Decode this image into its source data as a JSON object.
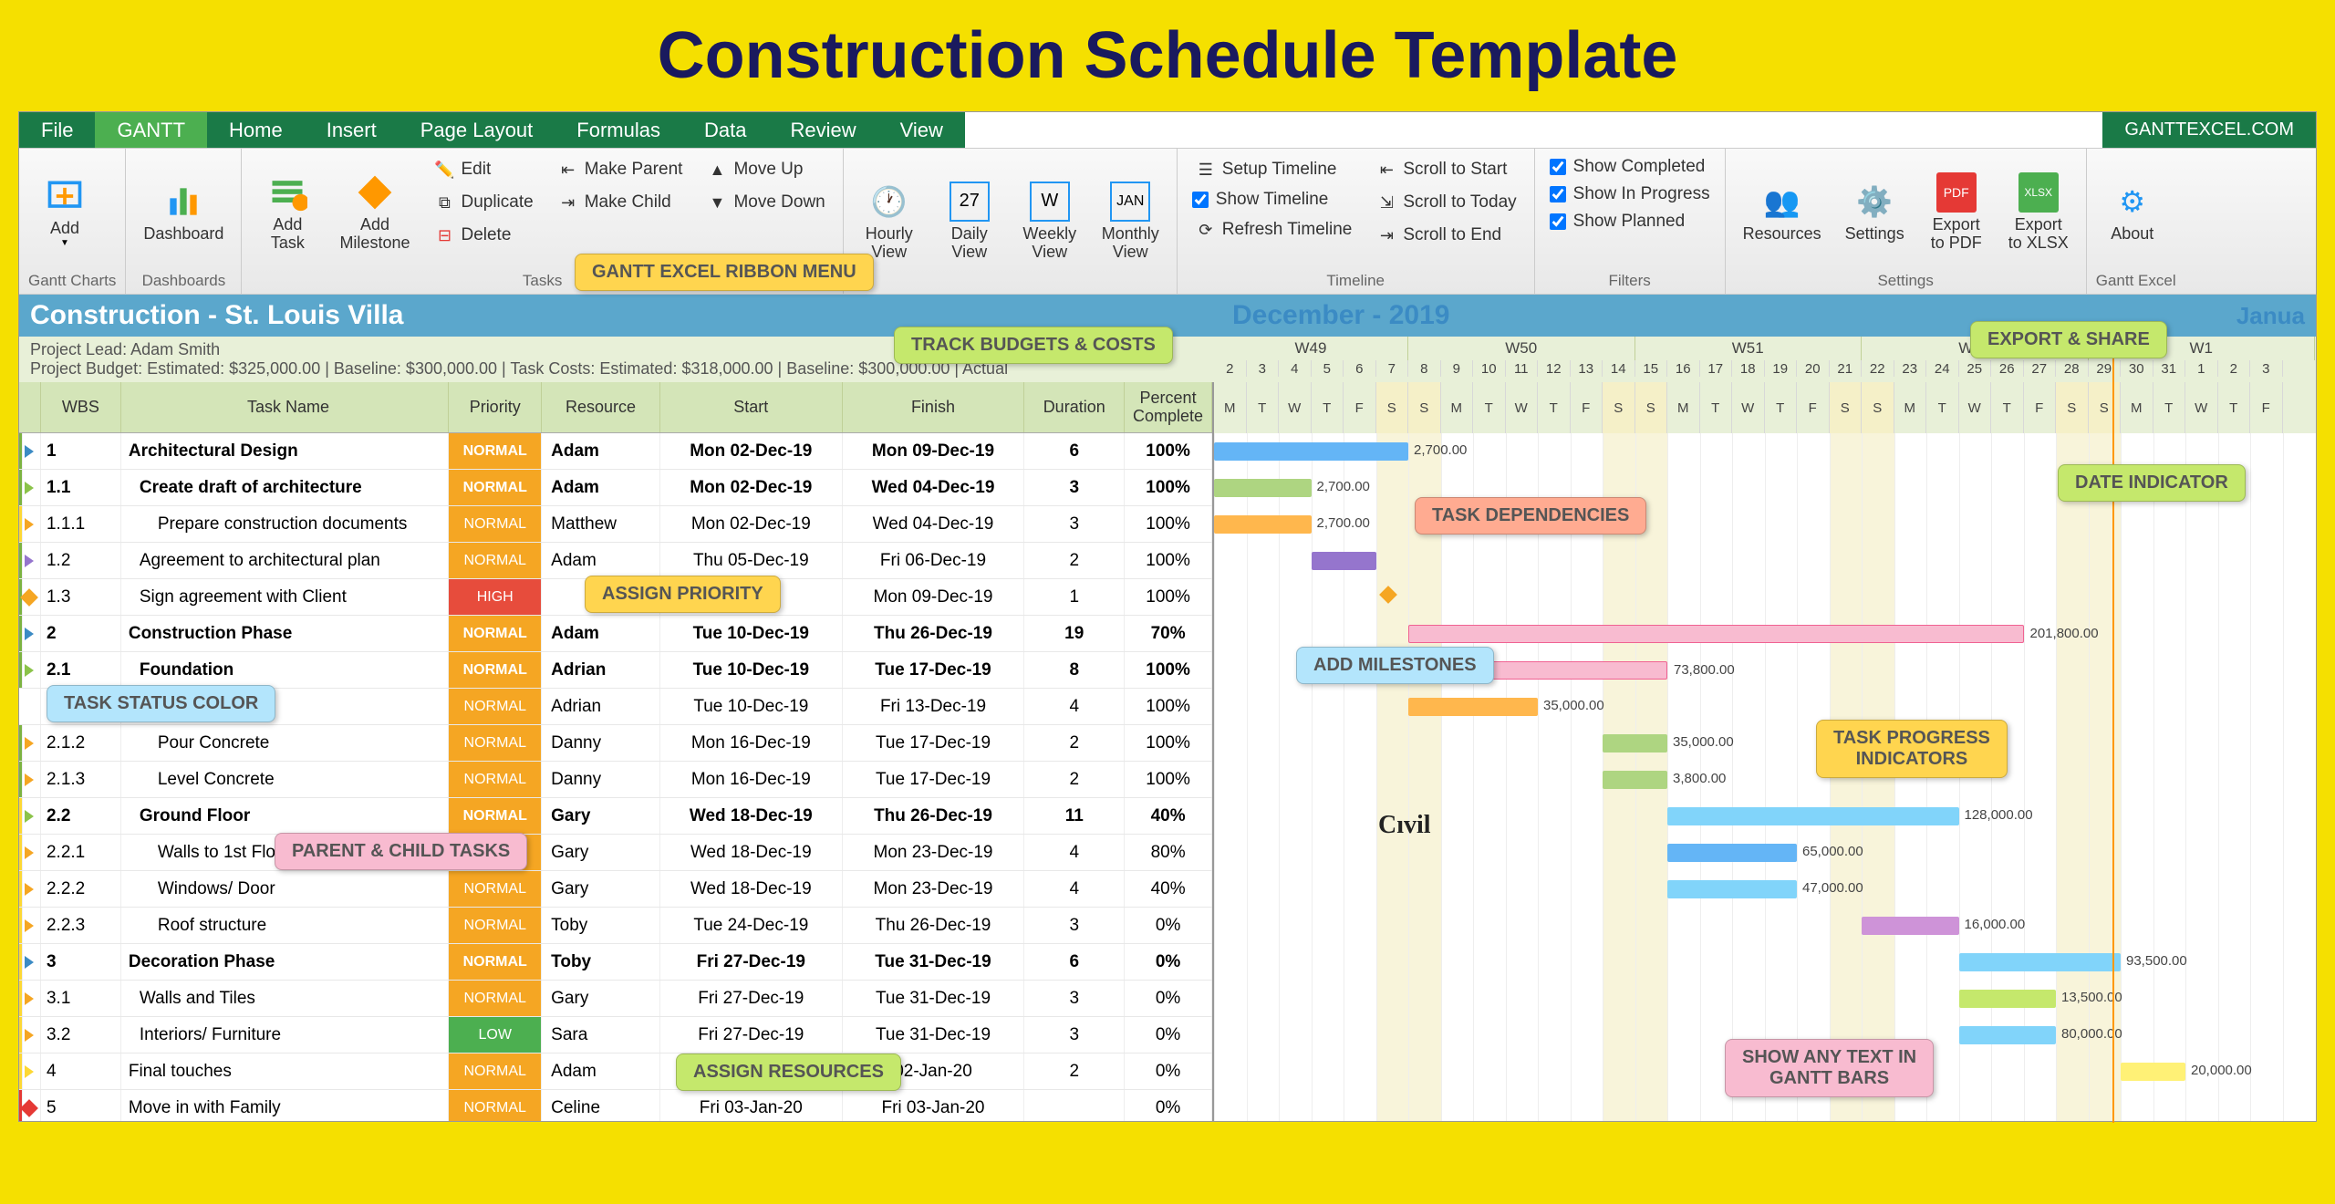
{
  "page_title": "Construction Schedule Template",
  "site_brand": "GANTTEXCEL.COM",
  "menu": {
    "file": "File",
    "gantt": "GANTT",
    "home": "Home",
    "insert": "Insert",
    "pagelayout": "Page Layout",
    "formulas": "Formulas",
    "data": "Data",
    "review": "Review",
    "view": "View"
  },
  "ribbon": {
    "gantt_charts": {
      "label": "Gantt Charts",
      "add": "Add"
    },
    "dashboards": {
      "label": "Dashboards",
      "btn": "Dashboard"
    },
    "tasks": {
      "label": "Tasks",
      "add_task": "Add\nTask",
      "add_milestone": "Add\nMilestone",
      "edit": "Edit",
      "duplicate": "Duplicate",
      "delete": "Delete",
      "make_parent": "Make Parent",
      "make_child": "Make Child",
      "move_up": "Move Up",
      "move_down": "Move Down"
    },
    "views": {
      "hourly": "Hourly\nView",
      "daily": "Daily\nView",
      "weekly": "Weekly\nView",
      "monthly": "Monthly\nView"
    },
    "timeline": {
      "label": "Timeline",
      "setup": "Setup Timeline",
      "show": "Show Timeline",
      "refresh": "Refresh Timeline",
      "scroll_start": "Scroll to Start",
      "scroll_today": "Scroll to Today",
      "scroll_end": "Scroll to End"
    },
    "filters": {
      "label": "Filters",
      "completed": "Show Completed",
      "in_progress": "Show In Progress",
      "planned": "Show Planned"
    },
    "settings": {
      "label": "Settings",
      "resources": "Resources",
      "settings": "Settings",
      "pdf": "Export\nto PDF",
      "xlsx": "Export\nto XLSX"
    },
    "about": {
      "label": "Gantt Excel",
      "btn": "About"
    }
  },
  "project": {
    "title": "Construction - St. Louis Villa",
    "lead": "Project Lead: Adam Smith",
    "budget": "Project Budget: Estimated: $325,000.00 | Baseline: $300,000.00 | Task Costs: Estimated: $318,000.00 | Baseline: $300,000.00 | Actual",
    "month": "December - 2019",
    "next_month": "Janua"
  },
  "columns": {
    "wbs": "WBS",
    "name": "Task Name",
    "priority": "Priority",
    "resource": "Resource",
    "start": "Start",
    "finish": "Finish",
    "duration": "Duration",
    "pct": "Percent\nComplete"
  },
  "weeks": [
    "W49",
    "W50",
    "W51",
    "W52",
    "W1"
  ],
  "day_nums": [
    "2",
    "3",
    "4",
    "5",
    "6",
    "7",
    "8",
    "9",
    "10",
    "11",
    "12",
    "13",
    "14",
    "15",
    "16",
    "17",
    "18",
    "19",
    "20",
    "21",
    "22",
    "23",
    "24",
    "25",
    "26",
    "27",
    "28",
    "29",
    "30",
    "31",
    "1",
    "2",
    "3"
  ],
  "day_letters": [
    "M",
    "T",
    "W",
    "T",
    "F",
    "S",
    "S",
    "M",
    "T",
    "W",
    "T",
    "F",
    "S",
    "S",
    "M",
    "T",
    "W",
    "T",
    "F",
    "S",
    "S",
    "M",
    "T",
    "W",
    "T",
    "F",
    "S",
    "S",
    "M",
    "T",
    "W",
    "T",
    "F"
  ],
  "rows": [
    {
      "status": "green",
      "marker": "#3b8bc4",
      "wbs": "1",
      "name": "Architectural Design",
      "bold": true,
      "pri": "NORMAL",
      "res": "Adam",
      "start": "Mon 02-Dec-19",
      "fin": "Mon 09-Dec-19",
      "dur": "6",
      "pct": "100%"
    },
    {
      "status": "green",
      "marker": "#8bc34a",
      "wbs": "1.1",
      "name": "Create draft of architecture",
      "bold": true,
      "pri": "NORMAL",
      "res": "Adam",
      "start": "Mon 02-Dec-19",
      "fin": "Wed 04-Dec-19",
      "dur": "3",
      "pct": "100%",
      "indent": 1
    },
    {
      "status": "yellow",
      "marker": "#f5a623",
      "wbs": "1.1.1",
      "name": "Prepare construction documents",
      "pri": "NORMAL",
      "res": "Matthew",
      "start": "Mon 02-Dec-19",
      "fin": "Wed 04-Dec-19",
      "dur": "3",
      "pct": "100%",
      "indent": 2
    },
    {
      "status": "green",
      "marker": "#9575cd",
      "wbs": "1.2",
      "name": "Agreement to architectural plan",
      "pri": "NORMAL",
      "res": "Adam",
      "start": "Thu 05-Dec-19",
      "fin": "Fri 06-Dec-19",
      "dur": "2",
      "pct": "100%",
      "indent": 1
    },
    {
      "status": "green",
      "marker": "#f5a623",
      "dia": true,
      "wbs": "1.3",
      "name": "Sign agreement with Client",
      "pri": "HIGH",
      "res": "",
      "start": "-19",
      "fin": "Mon 09-Dec-19",
      "dur": "1",
      "pct": "100%",
      "indent": 1
    },
    {
      "status": "green",
      "marker": "#3b8bc4",
      "wbs": "2",
      "name": "Construction Phase",
      "bold": true,
      "pri": "NORMAL",
      "res": "Adam",
      "start": "Tue 10-Dec-19",
      "fin": "Thu 26-Dec-19",
      "dur": "19",
      "pct": "70%"
    },
    {
      "status": "green",
      "marker": "#8bc34a",
      "wbs": "2.1",
      "name": "Foundation",
      "bold": true,
      "pri": "NORMAL",
      "res": "Adrian",
      "start": "Tue 10-Dec-19",
      "fin": "Tue 17-Dec-19",
      "dur": "8",
      "pct": "100%",
      "indent": 1
    },
    {
      "status": "",
      "marker": "",
      "wbs": "",
      "name": "",
      "pri": "NORMAL",
      "res": "Adrian",
      "start": "Tue 10-Dec-19",
      "fin": "Fri 13-Dec-19",
      "dur": "4",
      "pct": "100%",
      "indent": 2
    },
    {
      "status": "green",
      "marker": "#f5a623",
      "wbs": "2.1.2",
      "name": "Pour Concrete",
      "pri": "NORMAL",
      "res": "Danny",
      "start": "Mon 16-Dec-19",
      "fin": "Tue 17-Dec-19",
      "dur": "2",
      "pct": "100%",
      "indent": 2
    },
    {
      "status": "green",
      "marker": "#f5a623",
      "wbs": "2.1.3",
      "name": "Level Concrete",
      "pri": "NORMAL",
      "res": "Danny",
      "start": "Mon 16-Dec-19",
      "fin": "Tue 17-Dec-19",
      "dur": "2",
      "pct": "100%",
      "indent": 2
    },
    {
      "status": "yellow",
      "marker": "#8bc34a",
      "wbs": "2.2",
      "name": "Ground Floor",
      "bold": true,
      "pri": "NORMAL",
      "res": "Gary",
      "start": "Wed 18-Dec-19",
      "fin": "Thu 26-Dec-19",
      "dur": "11",
      "pct": "40%",
      "indent": 1
    },
    {
      "status": "yellow",
      "marker": "#f5a623",
      "wbs": "2.2.1",
      "name": "Walls to 1st Flo",
      "pri": "NORMAL",
      "res": "Gary",
      "start": "Wed 18-Dec-19",
      "fin": "Mon 23-Dec-19",
      "dur": "4",
      "pct": "80%",
      "indent": 2
    },
    {
      "status": "yellow",
      "marker": "#f5a623",
      "wbs": "2.2.2",
      "name": "Windows/ Door",
      "pri": "NORMAL",
      "res": "Gary",
      "start": "Wed 18-Dec-19",
      "fin": "Mon 23-Dec-19",
      "dur": "4",
      "pct": "40%",
      "indent": 2
    },
    {
      "status": "yellow",
      "marker": "#f5a623",
      "wbs": "2.2.3",
      "name": "Roof structure",
      "pri": "NORMAL",
      "res": "Toby",
      "start": "Tue 24-Dec-19",
      "fin": "Thu 26-Dec-19",
      "dur": "3",
      "pct": "0%",
      "indent": 2
    },
    {
      "status": "yellow",
      "marker": "#3b8bc4",
      "wbs": "3",
      "name": "Decoration Phase",
      "bold": true,
      "pri": "NORMAL",
      "res": "Toby",
      "start": "Fri 27-Dec-19",
      "fin": "Tue 31-Dec-19",
      "dur": "6",
      "pct": "0%"
    },
    {
      "status": "yellow",
      "marker": "#f5a623",
      "wbs": "3.1",
      "name": "Walls and Tiles",
      "pri": "NORMAL",
      "res": "Gary",
      "start": "Fri 27-Dec-19",
      "fin": "Tue 31-Dec-19",
      "dur": "3",
      "pct": "0%",
      "indent": 1
    },
    {
      "status": "yellow",
      "marker": "#f5a623",
      "wbs": "3.2",
      "name": "Interiors/ Furniture",
      "pri": "LOW",
      "res": "Sara",
      "start": "Fri 27-Dec-19",
      "fin": "Tue 31-Dec-19",
      "dur": "3",
      "pct": "0%",
      "indent": 1
    },
    {
      "status": "yellow",
      "marker": "#fdd835",
      "wbs": "4",
      "name": "Final touches",
      "pri": "NORMAL",
      "res": "Adam",
      "start": "",
      "fin": "02-Jan-20",
      "dur": "2",
      "pct": "0%"
    },
    {
      "status": "red",
      "marker": "#e53935",
      "dia": true,
      "wbs": "5",
      "name": "Move in with Family",
      "pri": "NORMAL",
      "res": "Celine",
      "start": "Fri 03-Jan-20",
      "fin": "Fri 03-Jan-20",
      "dur": "",
      "pct": "0%"
    }
  ],
  "gantt_bars": [
    {
      "row": 0,
      "start": 0,
      "len": 6,
      "color": "#64b5f6",
      "darker": "#1e88e5",
      "label": "2,700.00",
      "arrow": true
    },
    {
      "row": 1,
      "start": 0,
      "len": 3,
      "color": "#aed581",
      "label": "2,700.00",
      "arrow": true
    },
    {
      "row": 2,
      "start": 0,
      "len": 3,
      "color": "#ffb74d",
      "label": "2,700.00"
    },
    {
      "row": 3,
      "start": 3,
      "len": 2,
      "color": "#9575cd"
    },
    {
      "row": 4,
      "start": 5,
      "len": 0,
      "milestone": true,
      "color": "#f5a623"
    },
    {
      "row": 5,
      "start": 6,
      "len": 19,
      "color": "#f8bbd0",
      "border": "#f06292",
      "label": "201,800.00",
      "arrow": true
    },
    {
      "row": 6,
      "start": 6,
      "len": 8,
      "color": "#f8bbd0",
      "border": "#f06292",
      "label": "73,800.00",
      "arrow": true
    },
    {
      "row": 7,
      "start": 6,
      "len": 4,
      "color": "#ffb74d",
      "label": "35,000.00"
    },
    {
      "row": 8,
      "start": 12,
      "len": 2,
      "color": "#aed581",
      "label": "35,000.00"
    },
    {
      "row": 9,
      "start": 12,
      "len": 2,
      "color": "#aed581",
      "label": "3,800.00"
    },
    {
      "row": 10,
      "start": 14,
      "len": 9,
      "color": "#81d4fa",
      "label": "128,000.00",
      "arrow": true
    },
    {
      "row": 11,
      "start": 14,
      "len": 4,
      "color": "#64b5f6",
      "label": "65,000.00"
    },
    {
      "row": 12,
      "start": 14,
      "len": 4,
      "color": "#81d4fa",
      "label": "47,000.00"
    },
    {
      "row": 13,
      "start": 20,
      "len": 3,
      "color": "#ce93d8",
      "label": "16,000.00"
    },
    {
      "row": 14,
      "start": 23,
      "len": 5,
      "color": "#81d4fa",
      "label": "93,500.00",
      "arrow": true
    },
    {
      "row": 15,
      "start": 23,
      "len": 3,
      "color": "#c5e86c",
      "label": "13,500.00"
    },
    {
      "row": 16,
      "start": 23,
      "len": 3,
      "color": "#81d4fa",
      "label": "80,000.00"
    },
    {
      "row": 17,
      "start": 28,
      "len": 2,
      "color": "#fff176",
      "label": "20,000.00"
    }
  ],
  "callouts": {
    "ribbon_menu": "GANTT EXCEL RIBBON MENU",
    "track_budgets": "TRACK BUDGETS & COSTS",
    "export_share": "EXPORT & SHARE",
    "task_deps": "TASK DEPENDENCIES",
    "date_indicator": "DATE INDICATOR",
    "assign_priority": "ASSIGN PRIORITY",
    "add_milestones": "ADD MILESTONES",
    "task_status": "TASK STATUS COLOR",
    "task_progress": "TASK PROGRESS\nINDICATORS",
    "parent_child": "PARENT & CHILD TASKS",
    "assign_res": "ASSIGN RESOURCES",
    "show_text": "SHOW ANY TEXT IN\nGANTT BARS"
  },
  "logo_text": "Cıvil"
}
